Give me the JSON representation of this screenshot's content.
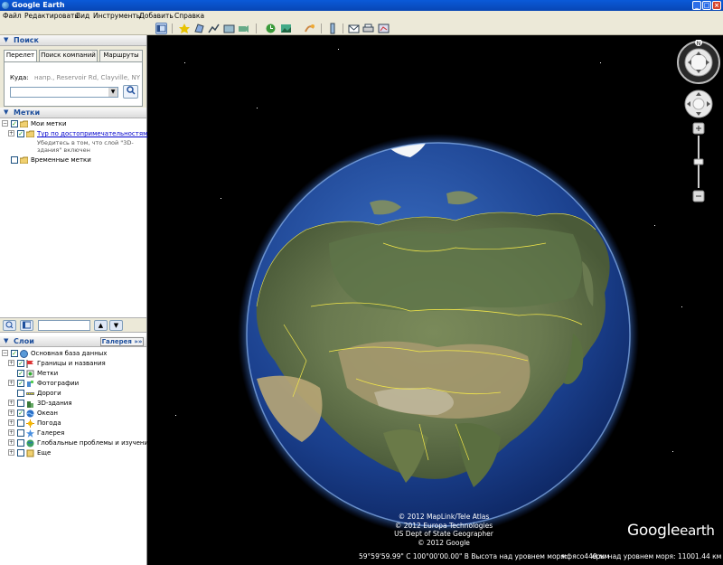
{
  "window": {
    "title": "Google Earth"
  },
  "menu": [
    "Файл",
    "Редактировать",
    "Вид",
    "Инструменты",
    "Добавить",
    "Справка"
  ],
  "search": {
    "header": "Поиск",
    "tabs": [
      "Перелет",
      "Поиск компаний",
      "Маршруты"
    ],
    "field_label": "Куда:",
    "hint": "напр., Reservoir Rd, Clayville, NY",
    "value": ""
  },
  "places": {
    "header": "Метки",
    "my_places": "Мои метки",
    "tour_link": "Тур по достопримечательностям",
    "tour_desc_1": "Убедитесь в том, что слой \"3D-",
    "tour_desc_2": "здания\" включен",
    "temp_places": "Временные метки"
  },
  "layers": {
    "header": "Слои",
    "gallery_button": "Галерея »»",
    "items": [
      {
        "label": "Основная база данных",
        "checked": true,
        "icon": "globe-icon"
      },
      {
        "label": "Границы и названия",
        "checked": true,
        "icon": "flag-icon"
      },
      {
        "label": "Метки",
        "checked": true,
        "icon": "placemark-icon"
      },
      {
        "label": "Фотографии",
        "checked": true,
        "icon": "photo-icon"
      },
      {
        "label": "Дороги",
        "checked": false,
        "icon": "road-icon"
      },
      {
        "label": "3D-здания",
        "checked": false,
        "icon": "building-icon"
      },
      {
        "label": "Океан",
        "checked": true,
        "icon": "ocean-icon"
      },
      {
        "label": "Погода",
        "checked": false,
        "icon": "weather-icon"
      },
      {
        "label": "Галерея",
        "checked": false,
        "icon": "gallery-icon"
      },
      {
        "label": "Глобальные проблемы и изучение ...",
        "checked": false,
        "icon": "earth-issues-icon"
      },
      {
        "label": "Еще",
        "checked": false,
        "icon": "more-icon"
      }
    ]
  },
  "map": {
    "credits": [
      "© 2012 MapLink/Tele Atlas",
      "© 2012 Europa Technologies",
      "US Dept of State Geographer",
      "© 2012 Google"
    ],
    "logo_google": "Google",
    "logo_earth": "earth",
    "status_coords": "59°59'59.99\" С 100°00'00.00\" В Высота над уровнем моря:",
    "status_elev": "мфясо440.мм",
    "status_eye": "еры над уровнем моря: 11001.44 км",
    "compass_north": "N"
  },
  "colors": {
    "titlebar": "#0846b4",
    "panel_header_text": "#1d4e9c",
    "border_yellow": "#f2e64a"
  }
}
